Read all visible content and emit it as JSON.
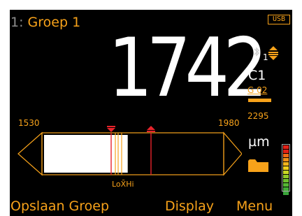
{
  "header": {
    "index": "1:",
    "group_name": "Groep 1",
    "usb_label": "USB"
  },
  "reading": {
    "value": "1742"
  },
  "status": {
    "count": "1",
    "icons": [
      "bluetooth-icon",
      "group-arrows-icon"
    ]
  },
  "side_panel": {
    "calibration": "C1",
    "group_code": "G 02",
    "max_value": "2295",
    "unit": "µm",
    "folder_icon": "folder-icon"
  },
  "scale": {
    "min_label": "1530",
    "max_label": "1980",
    "lo_hi_label": "LoX̄Hi",
    "min": 1530,
    "max": 1980,
    "fill_to": 1742
  },
  "level_meter": {
    "segments": 12,
    "colors": [
      "#e32016",
      "#e32016",
      "#f06a16",
      "#f29018",
      "#f2b31c",
      "#f2d01c",
      "#c8d623",
      "#93c928",
      "#6fbf2d",
      "#55b734",
      "#43ae37",
      "#3aa43a"
    ]
  },
  "softkeys": {
    "left": "Opslaan Groep",
    "middle": "Display",
    "right": "Menu"
  },
  "colors": {
    "accent": "#f7a21a",
    "marker_red": "#e8232b",
    "background": "#000000",
    "text": "#ffffff"
  }
}
